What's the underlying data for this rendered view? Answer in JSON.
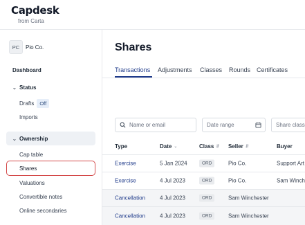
{
  "brand": {
    "logo": "Capdesk",
    "subtitle": "from Carta"
  },
  "company": {
    "initials": "PC",
    "name": "Pio Co."
  },
  "sidebar": {
    "dashboard": "Dashboard",
    "status": {
      "label": "Status",
      "items": [
        {
          "label": "Drafts",
          "badge": "Off"
        },
        {
          "label": "Imports"
        }
      ]
    },
    "ownership": {
      "label": "Ownership",
      "items": [
        {
          "label": "Cap table"
        },
        {
          "label": "Shares",
          "selected": true
        },
        {
          "label": "Valuations"
        },
        {
          "label": "Convertible notes"
        },
        {
          "label": "Online secondaries"
        }
      ]
    }
  },
  "page": {
    "title": "Shares",
    "tabs": [
      {
        "label": "Transactions",
        "active": true
      },
      {
        "label": "Adjustments"
      },
      {
        "label": "Classes"
      },
      {
        "label": "Rounds"
      },
      {
        "label": "Certificates"
      }
    ]
  },
  "filters": {
    "search_placeholder": "Name or email",
    "date_range": "Date range",
    "share_class": "Share class"
  },
  "table": {
    "headers": [
      "Type",
      "Date",
      "Class",
      "Seller",
      "Buyer"
    ],
    "rows": [
      {
        "type": "Exercise",
        "date": "5 Jan 2024",
        "class": "ORD",
        "seller": "Pio Co.",
        "buyer": "Support Art"
      },
      {
        "type": "Exercise",
        "date": "4 Jul 2023",
        "class": "ORD",
        "seller": "Pio Co.",
        "buyer": "Sam Winche"
      },
      {
        "type": "Cancellation",
        "date": "4 Jul 2023",
        "class": "ORD",
        "seller": "Sam Winchester",
        "buyer": ""
      },
      {
        "type": "Cancellation",
        "date": "4 Jul 2023",
        "class": "ORD",
        "seller": "Sam Winchester",
        "buyer": ""
      }
    ]
  },
  "colors": {
    "accent": "#1e3a8a",
    "selection_outline": "#d44a4a",
    "section_highlight": "#eef1f5"
  },
  "icons": {
    "search": "search-icon",
    "calendar": "calendar-icon",
    "chevron": "chevron-down-icon",
    "sort": "sort-icon"
  }
}
